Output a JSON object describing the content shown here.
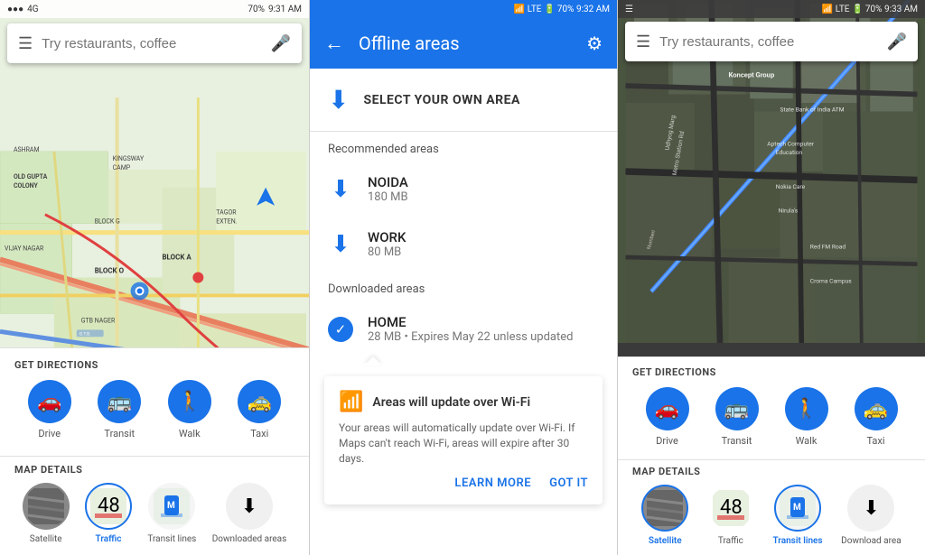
{
  "panel1": {
    "status_time": "9:31 AM",
    "battery": "70%",
    "search_placeholder": "Try restaurants, coffee",
    "get_directions_label": "GET DIRECTIONS",
    "directions": [
      {
        "label": "Drive",
        "icon": "🚗"
      },
      {
        "label": "Transit",
        "icon": "🚌"
      },
      {
        "label": "Walk",
        "icon": "🚶"
      },
      {
        "label": "Taxi",
        "icon": "🚕"
      }
    ],
    "map_details_label": "MAP DETAILS",
    "details": [
      {
        "label": "Satellite",
        "icon": "🛰",
        "active": false
      },
      {
        "label": "Traffic",
        "icon": "🚦",
        "active": true
      },
      {
        "label": "Transit lines",
        "icon": "Ⓜ",
        "active": false
      },
      {
        "label": "Download area",
        "icon": "⬇",
        "active": false
      }
    ]
  },
  "panel2": {
    "status_time": "9:32 AM",
    "battery": "70%",
    "title": "Offline areas",
    "select_own_area_label": "SELECT YOUR OWN AREA",
    "recommended_header": "Recommended areas",
    "recommended": [
      {
        "name": "NOIDA",
        "size": "180 MB"
      },
      {
        "name": "WORK",
        "size": "80 MB"
      }
    ],
    "downloaded_header": "Downloaded areas",
    "downloaded": [
      {
        "name": "HOME",
        "size": "28 MB",
        "expiry": "Expires May 22 unless updated"
      }
    ],
    "wifi_title": "Areas will update over Wi-Fi",
    "wifi_desc": "Your areas will automatically update over Wi-Fi. If Maps can't reach Wi-Fi, areas will expire after 30 days.",
    "learn_more": "LEARN MORE",
    "got_it": "GOT IT"
  },
  "panel3": {
    "status_time": "9:33 AM",
    "battery": "70%",
    "search_placeholder": "Try restaurants, coffee",
    "get_directions_label": "GET DIRECTIONS",
    "directions": [
      {
        "label": "Drive",
        "icon": "🚗"
      },
      {
        "label": "Transit",
        "icon": "🚌"
      },
      {
        "label": "Walk",
        "icon": "🚶"
      },
      {
        "label": "Taxi",
        "icon": "🚕"
      }
    ],
    "map_details_label": "MAP DETAILS",
    "details": [
      {
        "label": "Satellite",
        "icon": "🛰",
        "active": true
      },
      {
        "label": "Traffic",
        "icon": "🚦",
        "active": false
      },
      {
        "label": "Transit lines",
        "icon": "Ⓜ",
        "active": true
      },
      {
        "label": "Download area",
        "icon": "⬇",
        "active": false
      }
    ]
  }
}
